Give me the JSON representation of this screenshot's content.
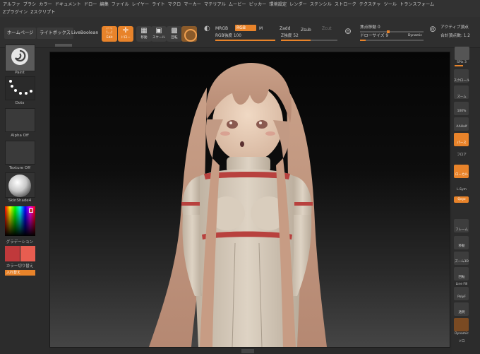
{
  "menu": {
    "row1": [
      "アルファ",
      "ブラシ",
      "カラー",
      "ドキュメント",
      "ドロー",
      "編集",
      "ファイル",
      "レイヤー",
      "ライト",
      "マクロ",
      "マーカー",
      "マテリアル",
      "ムービー",
      "ピッカー",
      "環境設定",
      "レンダー",
      "ステンシル",
      "ストローク",
      "テクスチャ",
      "ツール",
      "トランスフォーム"
    ],
    "row2": [
      "Zプラグイン",
      "Zスクリプト"
    ]
  },
  "toolbar": {
    "home_label": "ホームページ",
    "lightbox_label": "ライトボックス",
    "liveboolean_label": "LiveBoolean",
    "edit_label": "Edit",
    "draw_label": "ドロー",
    "move_label": "移動",
    "scale_label": "スケール",
    "rotate_label": "回転",
    "mrgb_label": "MRGB",
    "rgb_label": "RGB",
    "m_label": "M",
    "zadd_label": "Zadd",
    "zsub_label": "Zsub",
    "zcut_label": "Zcut",
    "rgb_intensity_label": "RGB強度 100",
    "z_intensity_label": "Z強度 52",
    "focal_shift_label": "焦点移動 0",
    "draw_size_label": "ドローサイズ 9",
    "dynamic_label": "Dynamic",
    "active_points_label": "アクティブ頂点",
    "total_points_label": "合計頂点数: 1.2"
  },
  "left_shelf": {
    "brush_label": "Paint",
    "stroke_label": "Dots",
    "alpha_label": "Alpha Off",
    "texture_label": "Texture Off",
    "material_label": "SkinShade4",
    "gradient_label": "グラデーション",
    "color_switch_label": "カラー切り替え",
    "swap_label": "入れ替え"
  },
  "right_shelf": {
    "spix_label": "SPix 3",
    "scroll_label": "スクロール",
    "zoom_label": "ズーム",
    "actual_label": "100%",
    "aahalf_label": "AAHalf",
    "persp_label": "パース",
    "floor_label": "フロア",
    "local_label": "ローカル",
    "lsym_label": "L.Sym",
    "xyz_label": "Qxyz",
    "frame_label": "フレーム",
    "move_label": "移動",
    "zoom3d_label": "ズーム3D",
    "rotate_label": "回転",
    "linefill_label": "Line Fill",
    "polyf_label": "PolyF",
    "transp_label": "透明",
    "dynamic_label": "Dynamic",
    "solo_label": "ソロ"
  },
  "colors": {
    "accent": "#e8832a",
    "primary_color": "#c0393b",
    "secondary_color": "#e85d50"
  }
}
